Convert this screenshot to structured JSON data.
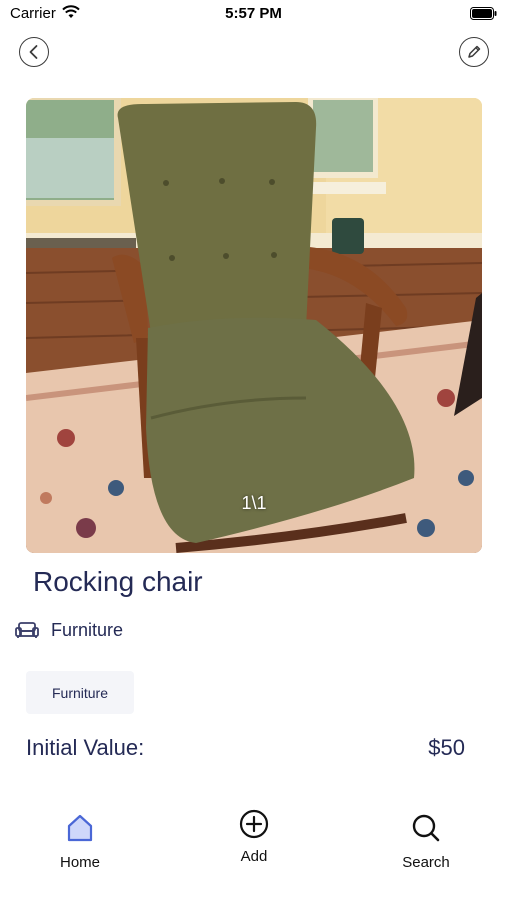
{
  "status_bar": {
    "carrier": "Carrier",
    "time": "5:57 PM"
  },
  "header": {
    "back_icon": "chevron-left-icon",
    "edit_icon": "pencil-icon"
  },
  "item": {
    "photo_counter": "1\\1",
    "title": "Rocking chair",
    "category_icon": "sofa-icon",
    "category": "Furniture",
    "tag": "Furniture",
    "value_label": "Initial Value:",
    "value": "$50"
  },
  "tab_bar": {
    "home": {
      "label": "Home",
      "icon": "home-icon"
    },
    "add": {
      "label": "Add",
      "icon": "add-circle-icon"
    },
    "search": {
      "label": "Search",
      "icon": "search-icon"
    }
  },
  "colors": {
    "accent": "#4a67d6",
    "text": "#242a55",
    "chip_bg": "#f4f5f9"
  }
}
